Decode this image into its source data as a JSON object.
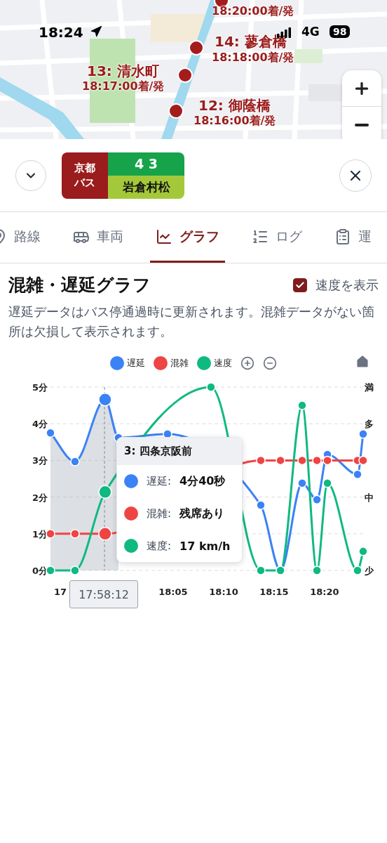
{
  "status_bar": {
    "time": "18:24",
    "network": "4G",
    "battery": "98"
  },
  "map": {
    "stops": [
      {
        "time": "18:20:00着/発"
      },
      {
        "label": "14: 蓼倉橋",
        "time": "18:18:00着/発"
      },
      {
        "label": "13: 清水町",
        "time": "18:17:00着/発"
      },
      {
        "label": "12: 御蔭橋",
        "time": "18:16:00着/発"
      }
    ]
  },
  "route": {
    "operator": [
      "京都",
      "バス"
    ],
    "number": "4 3",
    "destination": "岩倉村松"
  },
  "tabs": [
    {
      "label": "路線",
      "selected": false
    },
    {
      "label": "車両",
      "selected": false
    },
    {
      "label": "グラフ",
      "selected": true
    },
    {
      "label": "ログ",
      "selected": false
    },
    {
      "label": "運",
      "selected": false
    }
  ],
  "graph": {
    "title": "混雑・遅延グラフ",
    "show_speed": {
      "label": "速度を表示",
      "checked": true
    },
    "description": "遅延データはバス停通過時に更新されます。混雑データがない箇所は欠損して表示されます。",
    "chart_data": {
      "type": "line",
      "x": [
        17.8808,
        17.9213,
        17.971,
        17.993,
        18.074,
        18.1458,
        18.228,
        18.2605,
        18.2963,
        18.3207,
        18.338,
        18.3877,
        18.397
      ],
      "series": [
        {
          "name": "遅延",
          "color": "#3b82f6",
          "marker": "circle",
          "values": [
            3.75,
            2.97,
            4.66,
            3.62,
            3.72,
            null,
            1.78,
            0,
            2.38,
            1.93,
            3.16,
            2.62,
            3.72
          ]
        },
        {
          "name": "混雑",
          "color": "#ef4444",
          "marker": "circle",
          "values": [
            1,
            1,
            1,
            null,
            null,
            null,
            3,
            3,
            3,
            3,
            3,
            3,
            3
          ]
        },
        {
          "name": "速度",
          "color": "#10b981",
          "marker": "circle",
          "values": [
            0,
            0,
            2.14,
            null,
            null,
            5,
            0,
            0,
            4.5,
            0,
            2.38,
            0,
            0.52
          ]
        }
      ],
      "grid": true,
      "xlim": [
        17.8808,
        18.397
      ],
      "ylim": [
        0,
        5
      ],
      "xticks": [
        {
          "value": 18.0833,
          "label": "18:05"
        },
        {
          "value": 18.1667,
          "label": "18:10"
        },
        {
          "value": 18.25,
          "label": "18:15"
        },
        {
          "value": 18.3333,
          "label": "18:20"
        }
      ],
      "yticks": [
        {
          "value": 0,
          "label": "0分"
        },
        {
          "value": 1,
          "label": "1分"
        },
        {
          "value": 2,
          "label": "2分"
        },
        {
          "value": 3,
          "label": "3分"
        },
        {
          "value": 4,
          "label": "4分"
        },
        {
          "value": 5,
          "label": "5分"
        }
      ],
      "ref_lines": [
        {
          "axis": "x",
          "value": 17.97
        }
      ]
    },
    "pointer_label": "17:58:12",
    "partial_tick_label": "17",
    "congestion_axis": [
      "満",
      "多",
      "中",
      "少"
    ],
    "tooltip": {
      "title": "3: 四条京阪前",
      "rows": [
        {
          "label": "遅延:",
          "value": "4分40秒"
        },
        {
          "label": "混雑:",
          "value": "残席あり"
        },
        {
          "label": "速度:",
          "value": "17 km/h"
        }
      ]
    }
  }
}
